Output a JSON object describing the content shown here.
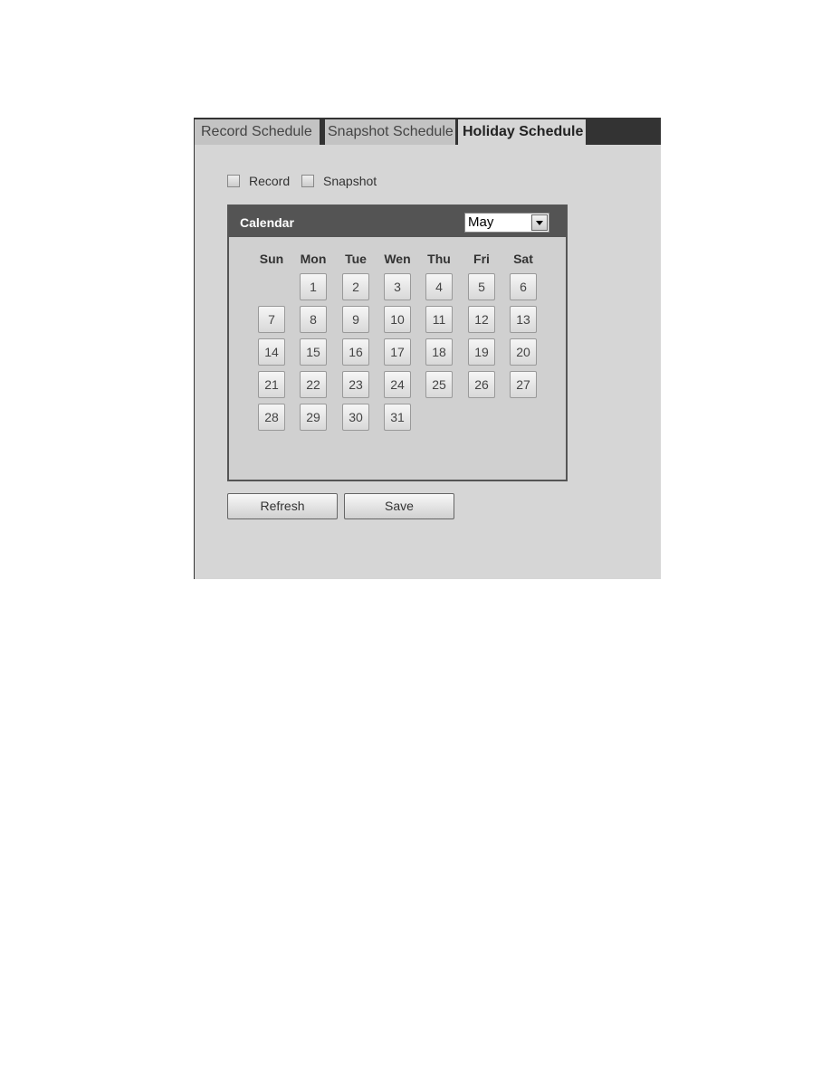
{
  "tabs": [
    {
      "label": "Record Schedule"
    },
    {
      "label": "Snapshot Schedule"
    },
    {
      "label": "Holiday Schedule",
      "active": true
    }
  ],
  "checkboxes": [
    {
      "label": "Record",
      "checked": false
    },
    {
      "label": "Snapshot",
      "checked": false
    }
  ],
  "calendar": {
    "title": "Calendar",
    "month": "May",
    "weekdays": [
      "Sun",
      "Mon",
      "Tue",
      "Wen",
      "Thu",
      "Fri",
      "Sat"
    ],
    "first_weekday_index": 1,
    "days": [
      "1",
      "2",
      "3",
      "4",
      "5",
      "6",
      "7",
      "8",
      "9",
      "10",
      "11",
      "12",
      "13",
      "14",
      "15",
      "16",
      "17",
      "18",
      "19",
      "20",
      "21",
      "22",
      "23",
      "24",
      "25",
      "26",
      "27",
      "28",
      "29",
      "30",
      "31"
    ]
  },
  "buttons": {
    "refresh": "Refresh",
    "save": "Save"
  }
}
